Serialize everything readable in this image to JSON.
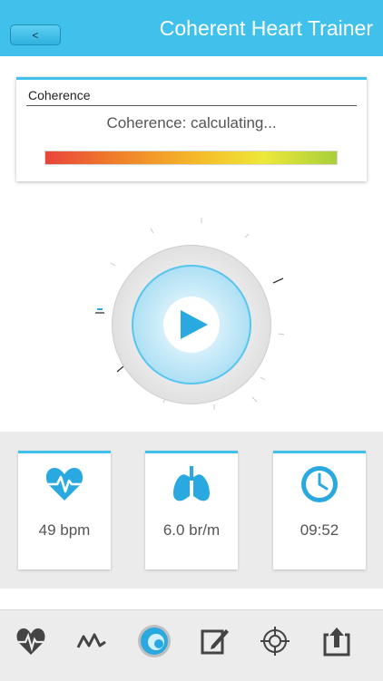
{
  "header": {
    "back_label": "<",
    "title": "Coherent Heart Trainer"
  },
  "coherence": {
    "title": "Coherence",
    "status": "Coherence: calculating..."
  },
  "stats": [
    {
      "icon": "heart-rate-icon",
      "value": "49 bpm"
    },
    {
      "icon": "lungs-icon",
      "value": "6.0 br/m"
    },
    {
      "icon": "clock-icon",
      "value": "09:52"
    }
  ],
  "tabs": [
    {
      "icon": "heart-pulse-icon"
    },
    {
      "icon": "waveform-icon"
    },
    {
      "icon": "coherence-globe-icon",
      "active": true
    },
    {
      "icon": "edit-note-icon"
    },
    {
      "icon": "target-icon"
    },
    {
      "icon": "share-icon"
    }
  ],
  "colors": {
    "accent": "#3fc1ec",
    "icon_blue": "#29a9e0"
  }
}
